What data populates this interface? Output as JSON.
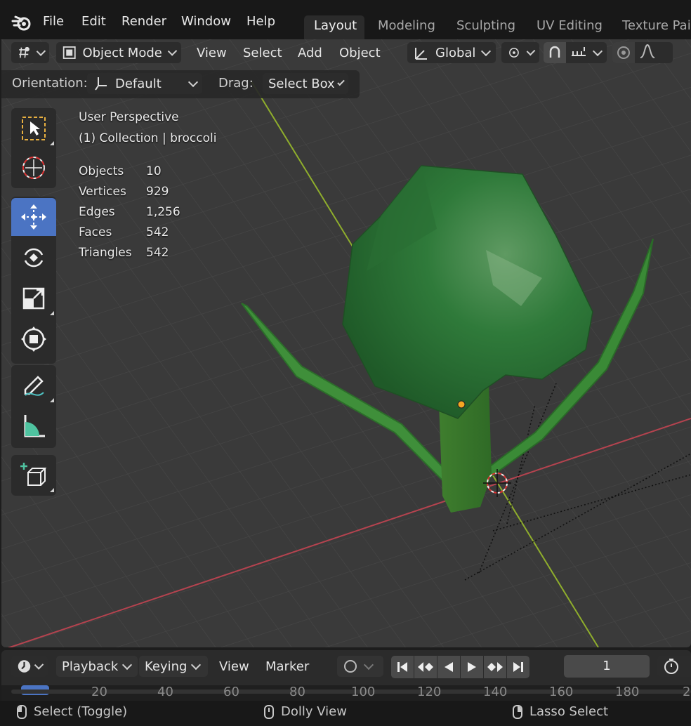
{
  "menu": {
    "items": [
      "File",
      "Edit",
      "Render",
      "Window",
      "Help"
    ]
  },
  "workspaces": {
    "tabs": [
      "Layout",
      "Modeling",
      "Sculpting",
      "UV Editing",
      "Texture Pai"
    ],
    "active": "Layout"
  },
  "viewport_header": {
    "mode": "Object Mode",
    "menus": [
      "View",
      "Select",
      "Add",
      "Object"
    ],
    "transform_orientation": "Global"
  },
  "tool_settings": {
    "orientation_label": "Orientation:",
    "orientation_value": "Default",
    "drag_label": "Drag:",
    "drag_value": "Select Box"
  },
  "overlay": {
    "view_name": "User Perspective",
    "collection": "(1) Collection | broccoli",
    "stats": [
      {
        "label": "Objects",
        "value": "10"
      },
      {
        "label": "Vertices",
        "value": "929"
      },
      {
        "label": "Edges",
        "value": "1,256"
      },
      {
        "label": "Faces",
        "value": "542"
      },
      {
        "label": "Triangles",
        "value": "542"
      }
    ]
  },
  "toolbar": {
    "tools": [
      "select-box-icon",
      "cursor-icon",
      "move-icon",
      "rotate-icon",
      "scale-icon",
      "transform-icon",
      "annotate-icon",
      "measure-icon",
      "add-cube-icon"
    ],
    "active": "move-icon"
  },
  "timeline": {
    "menus": [
      "Playback",
      "Keying",
      "View",
      "Marker"
    ],
    "current_frame": "1",
    "ruler_ticks": [
      "20",
      "40",
      "60",
      "80",
      "100",
      "120",
      "140",
      "160",
      "180",
      "2"
    ]
  },
  "statusbar": {
    "left": "Select (Toggle)",
    "middle": "Dolly View",
    "right": "Lasso Select"
  },
  "colors": {
    "active_blue": "#4b74c3",
    "broccoli_green": "#2f7a3a",
    "x_axis": "#b5434f",
    "y_axis": "#8fae2c",
    "origin_dot": "#f5a623"
  }
}
